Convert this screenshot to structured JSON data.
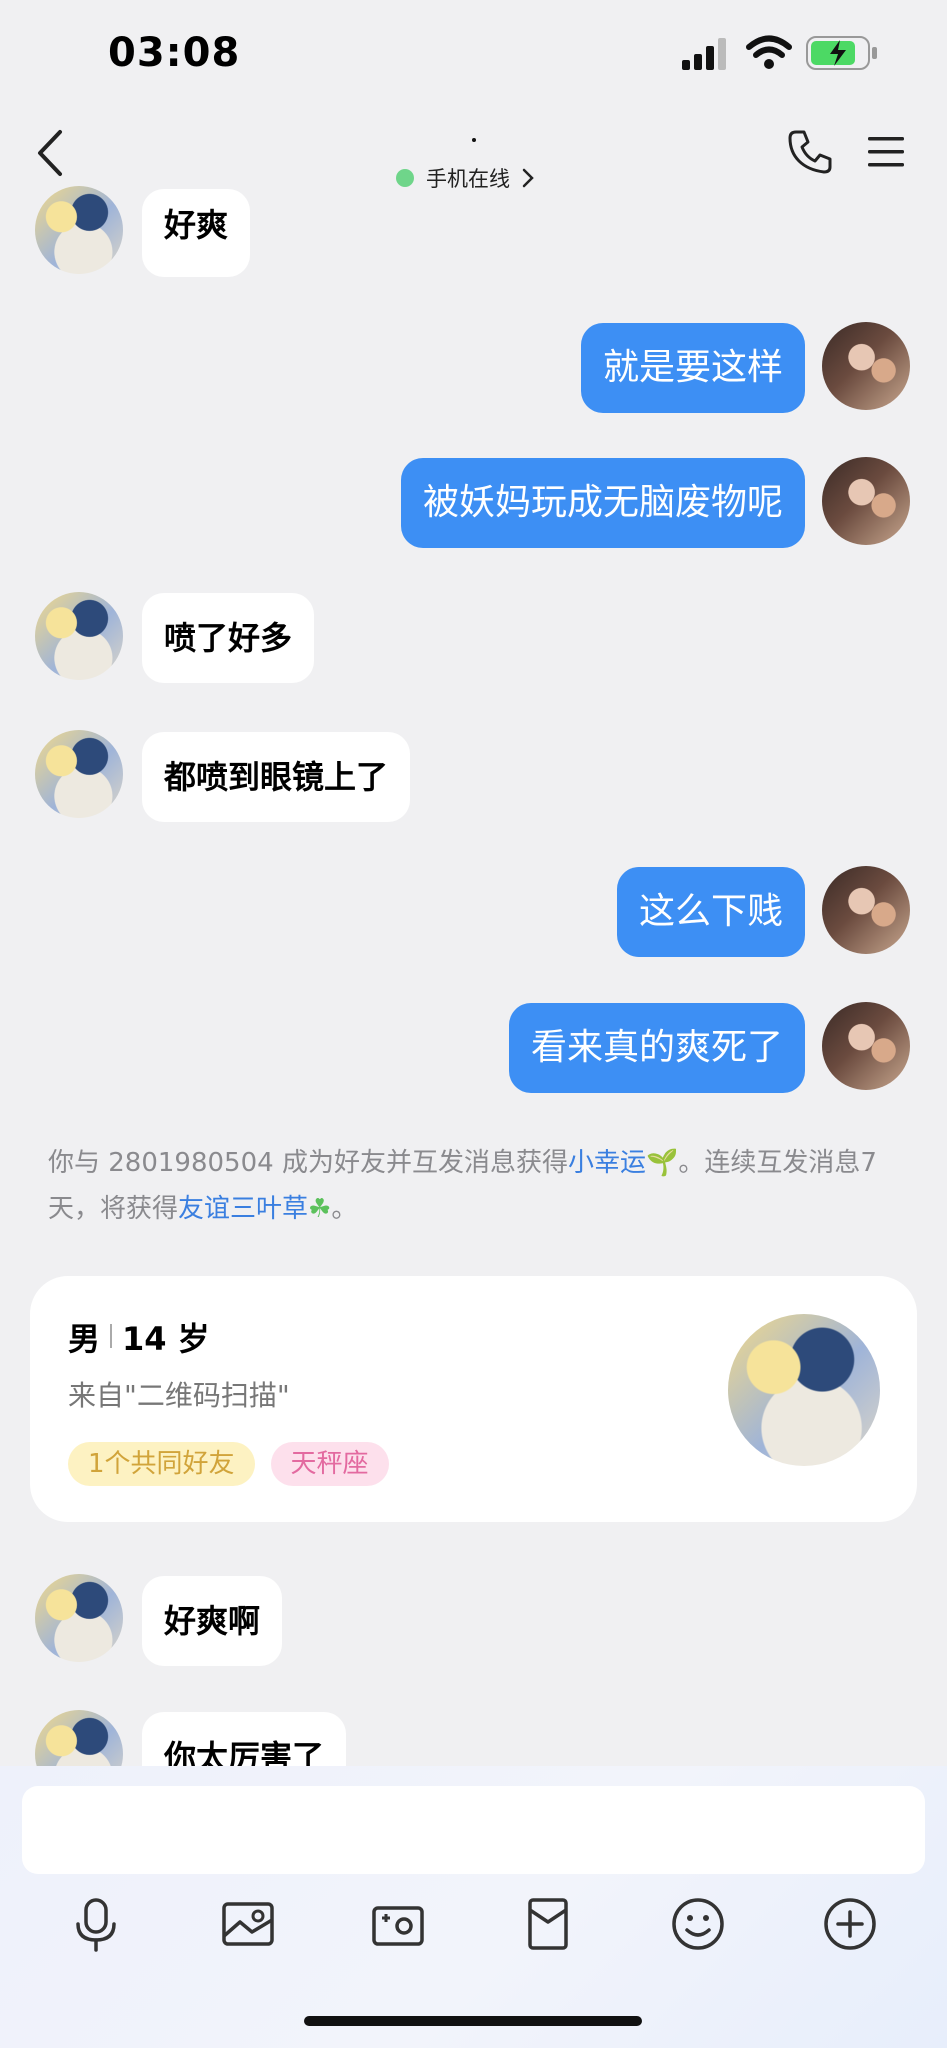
{
  "status_bar": {
    "time": "03:08"
  },
  "header": {
    "title": "·",
    "online_status": "手机在线"
  },
  "messages": [
    {
      "side": "in",
      "text": "好爽"
    },
    {
      "side": "out",
      "text": "就是要这样"
    },
    {
      "side": "out",
      "text": "被妖妈玩成无脑废物呢"
    },
    {
      "side": "in",
      "text": "喷了好多"
    },
    {
      "side": "in",
      "text": "都喷到眼镜上了"
    },
    {
      "side": "out",
      "text": "这么下贱"
    },
    {
      "side": "out",
      "text": "看来真的爽死了"
    },
    {
      "side": "in",
      "text": "好爽啊"
    },
    {
      "side": "in",
      "text": "你太厉害了"
    }
  ],
  "notice": {
    "part1": "你与 2801980504 成为好友并互发消息获得",
    "link1": "小幸运",
    "emoji1": "🌱",
    "part2": "。连续互发消息7天，将获得",
    "link2": "友谊三叶草",
    "emoji2": "☘",
    "part3": "。"
  },
  "profile_card": {
    "gender": "男",
    "age": "14 岁",
    "source": "来自\"二维码扫描\"",
    "tags": [
      "1个共同好友",
      "天秤座"
    ]
  },
  "toolbar": {
    "icons": [
      "microphone-icon",
      "image-icon",
      "camera-icon",
      "red-packet-icon",
      "emoji-icon",
      "plus-icon"
    ]
  },
  "colors": {
    "bubble_out": "#3d8ff4",
    "online_dot": "#6fd58a",
    "link": "#3a7fe0"
  }
}
